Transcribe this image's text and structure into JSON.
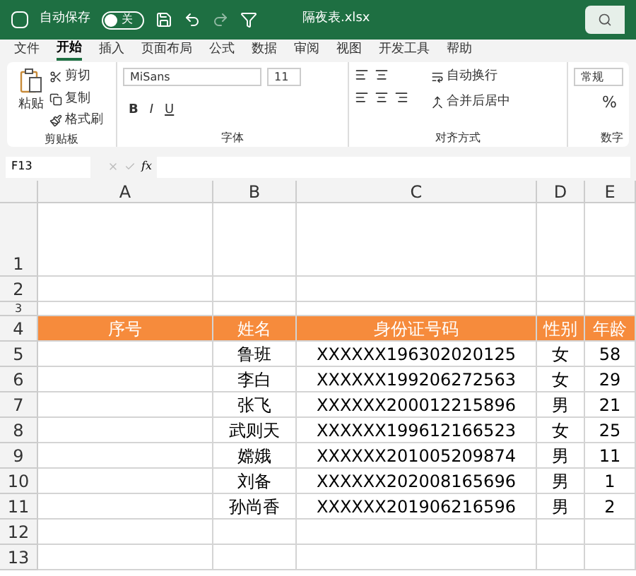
{
  "title_bar": {
    "autosave_label": "自动保存",
    "autosave_on": false,
    "autosave_state": "关",
    "filename": "隔夜表.xlsx"
  },
  "menu_tabs": [
    {
      "label": "文件",
      "selected": false
    },
    {
      "label": "开始",
      "selected": true
    },
    {
      "label": "插入",
      "selected": false
    },
    {
      "label": "页面布局",
      "selected": false
    },
    {
      "label": "公式",
      "selected": false
    },
    {
      "label": "数据",
      "selected": false
    },
    {
      "label": "审阅",
      "selected": false
    },
    {
      "label": "视图",
      "selected": false
    },
    {
      "label": "开发工具",
      "selected": false
    },
    {
      "label": "帮助",
      "selected": false
    }
  ],
  "ribbon": {
    "clipboard": {
      "paste": "粘贴",
      "cut": "剪切",
      "copy": "复制",
      "format_painter": "格式刷",
      "label": "剪贴板"
    },
    "font": {
      "name": "MiSans",
      "size": "11",
      "bold": "B",
      "italic": "I",
      "underline": "U",
      "label": "字体"
    },
    "alignment": {
      "wrap": "自动换行",
      "merge": "合并后居中",
      "label": "对齐方式"
    },
    "number": {
      "format": "常规",
      "percent": "%",
      "label": "数字"
    }
  },
  "formula_bar": {
    "cell_ref": "F13",
    "fx": "fx"
  },
  "columns": [
    "A",
    "B",
    "C",
    "D",
    "E"
  ],
  "rows": [
    {
      "number": "1",
      "kind": "tall",
      "cells": []
    },
    {
      "number": "2",
      "kind": "blank",
      "cells": []
    },
    {
      "number": "3",
      "kind": "short",
      "cells": []
    },
    {
      "number": "4",
      "kind": "header",
      "cells": [
        "序号",
        "姓名",
        "身份证号码",
        "性别",
        "年龄"
      ]
    },
    {
      "number": "5",
      "kind": "data",
      "cells": [
        "",
        "鲁班",
        "XXXXXX196302020125",
        "女",
        "58"
      ]
    },
    {
      "number": "6",
      "kind": "data",
      "cells": [
        "",
        "李白",
        "XXXXXX199206272563",
        "女",
        "29"
      ]
    },
    {
      "number": "7",
      "kind": "data",
      "cells": [
        "",
        "张飞",
        "XXXXXX200012215896",
        "男",
        "21"
      ]
    },
    {
      "number": "8",
      "kind": "data",
      "cells": [
        "",
        "武则天",
        "XXXXXX199612166523",
        "女",
        "25"
      ]
    },
    {
      "number": "9",
      "kind": "data",
      "cells": [
        "",
        "嫦娥",
        "XXXXXX201005209874",
        "男",
        "11"
      ]
    },
    {
      "number": "10",
      "kind": "data",
      "cells": [
        "",
        "刘备",
        "XXXXXX202008165696",
        "男",
        "1"
      ]
    },
    {
      "number": "11",
      "kind": "data",
      "cells": [
        "",
        "孙尚香",
        "XXXXXX201906216596",
        "男",
        "2"
      ]
    },
    {
      "number": "12",
      "kind": "blank",
      "cells": []
    },
    {
      "number": "13",
      "kind": "blank",
      "cells": []
    }
  ]
}
